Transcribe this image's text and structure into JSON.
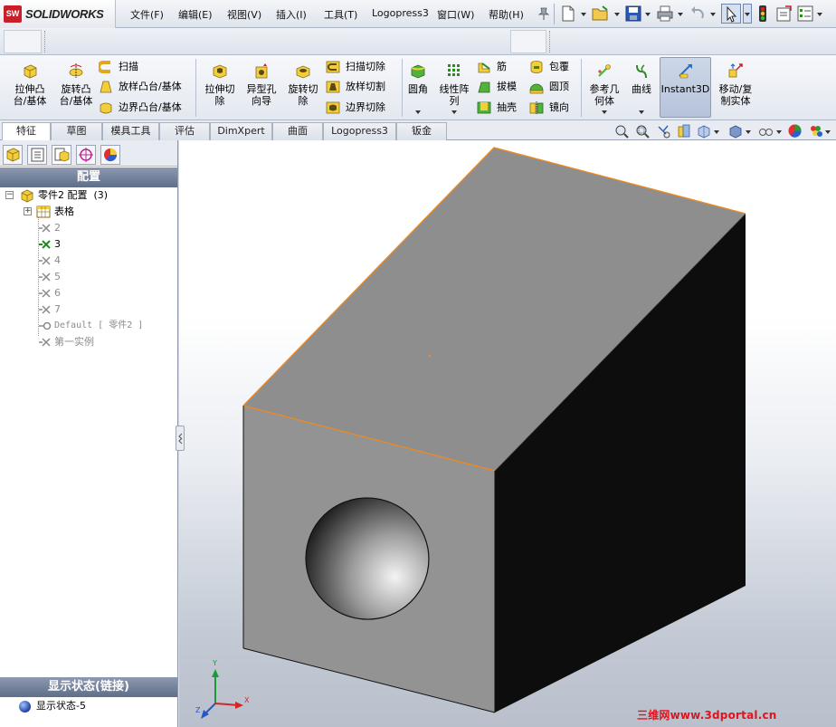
{
  "app": {
    "logo_text": "SOLIDWORKS",
    "logo_mark": "SW"
  },
  "menu": [
    "文件(F)",
    "编辑(E)",
    "视图(V)",
    "插入(I)",
    "工具(T)",
    "Logopress3",
    "窗口(W)",
    "帮助(H)"
  ],
  "ribbon": {
    "extrude_boss": "拉伸凸\n台/基体",
    "revolve_boss": "旋转凸\n台/基体",
    "sweep": "扫描",
    "loft_boss": "放样凸台/基体",
    "boundary_boss": "边界凸台/基体",
    "extrude_cut": "拉伸切\n除",
    "hole_wizard": "异型孔\n向导",
    "revolve_cut": "旋转切\n除",
    "sweep_cut": "扫描切除",
    "loft_cut": "放样切割",
    "boundary_cut": "边界切除",
    "fillet": "圆角",
    "linear_pattern": "线性阵\n列",
    "rib": "筋",
    "draft": "拔模",
    "shell": "抽壳",
    "wrap": "包覆",
    "dome": "圆顶",
    "mirror": "镜向",
    "ref_geometry": "参考几\n何体",
    "curves": "曲线",
    "instant3d": "Instant3D",
    "move_copy": "移动/复\n制实体"
  },
  "tabs": [
    "特征",
    "草图",
    "模具工具",
    "评估",
    "DimXpert",
    "曲面",
    "Logopress3",
    "钣金"
  ],
  "active_tab": "特征",
  "config_panel": {
    "header": "配置",
    "root": "零件2 配置  (3)",
    "tables": "表格",
    "items": [
      {
        "label": "2",
        "active": false
      },
      {
        "label": "3",
        "active": true
      },
      {
        "label": "4",
        "active": false
      },
      {
        "label": "5",
        "active": false
      },
      {
        "label": "6",
        "active": false
      },
      {
        "label": "7",
        "active": false
      },
      {
        "label": "Default [ 零件2 ]",
        "active": false
      },
      {
        "label": "第一实例",
        "active": false
      }
    ]
  },
  "display_panel": {
    "header": "显示状态(链接)",
    "item": "显示状态-5"
  },
  "watermark": "三维网www.3dportal.cn",
  "colors": {
    "accent_orange": "#f08a1c",
    "box_top": "#8e8e8e",
    "box_front": "#939393",
    "box_side": "#111111",
    "watermark": "#e0141e"
  }
}
